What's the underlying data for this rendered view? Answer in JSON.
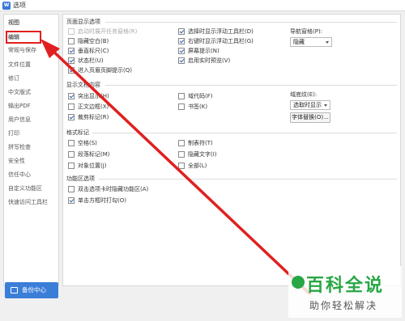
{
  "window": {
    "title": "选项",
    "icon": "wps-app-icon"
  },
  "sidebar": {
    "items": [
      {
        "label": "视图"
      },
      {
        "label": "编辑"
      },
      {
        "label": "常规与保存"
      },
      {
        "label": "文件位置"
      },
      {
        "label": "修订"
      },
      {
        "label": "中文版式"
      },
      {
        "label": "输出PDF"
      },
      {
        "label": "用户信息"
      },
      {
        "label": "打印"
      },
      {
        "label": "拼写检查"
      },
      {
        "label": "安全性"
      },
      {
        "label": "信任中心"
      },
      {
        "label": "自定义功能区"
      },
      {
        "label": "快速访问工具栏"
      }
    ],
    "backup_label": "备份中心"
  },
  "page_display": {
    "title": "页面显示选项",
    "options": [
      {
        "label": "启动时展开任务窗格(R)",
        "checked": false,
        "disabled": true
      },
      {
        "label": "隐藏空白(B)",
        "checked": false
      },
      {
        "label": "垂直标尺(C)",
        "checked": true
      },
      {
        "label": "状态栏(U)",
        "checked": true
      },
      {
        "label": "进入页眉页脚提示(Q)",
        "checked": true
      },
      {
        "label": "选择时显示浮动工具栏(D)",
        "checked": true
      },
      {
        "label": "右键时显示浮动工具栏(G)",
        "checked": true
      },
      {
        "label": "屏幕提示(N)",
        "checked": true
      },
      {
        "label": "启用实时预览(V)",
        "checked": true
      }
    ],
    "nav_pane_label": "导航窗格(P):",
    "nav_pane_value": "隐藏"
  },
  "display_content": {
    "title": "显示文档内容",
    "options": [
      {
        "label": "突出显示(H)",
        "checked": true
      },
      {
        "label": "正文边框(X)",
        "checked": false
      },
      {
        "label": "裁剪标记(R)",
        "checked": true
      },
      {
        "label": "域代码(F)",
        "checked": false
      },
      {
        "label": "书签(K)",
        "checked": false
      }
    ],
    "field_shading_label": "域底纹(E):",
    "field_shading_value": "选取时显示",
    "font_replace_button": "字体替换(O)..."
  },
  "format_marks": {
    "title": "格式标记",
    "options": [
      {
        "label": "空格(S)",
        "checked": false
      },
      {
        "label": "段落标记(M)",
        "checked": false
      },
      {
        "label": "对象位置(J)",
        "checked": false
      },
      {
        "label": "制表符(T)",
        "checked": false
      },
      {
        "label": "隐藏文字(I)",
        "checked": false
      },
      {
        "label": "全部(L)",
        "checked": false
      }
    ]
  },
  "ribbon": {
    "title": "功能区选项",
    "options": [
      {
        "label": "双击选项卡时隐藏功能区(A)",
        "checked": false
      },
      {
        "label": "单击方框时打勾(O)",
        "checked": true
      }
    ]
  },
  "annotation": {
    "highlight_color": "#e02020"
  },
  "watermark": {
    "logo_text": "百科全说",
    "sub_text": "助你轻松解决",
    "brand_color": "#28a745"
  }
}
